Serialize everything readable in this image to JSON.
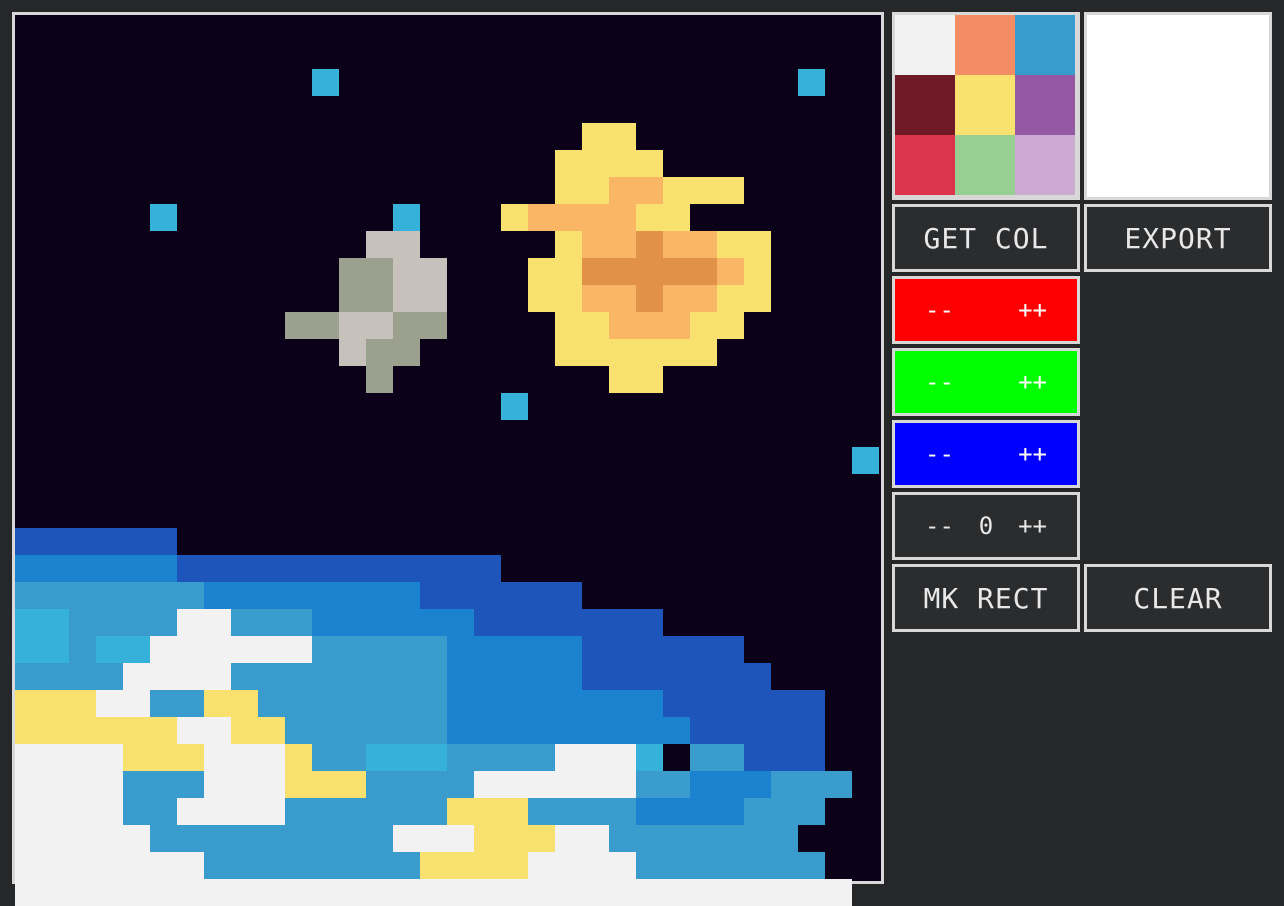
{
  "palette": {
    "colors": [
      "#f2f2f2",
      "#f48c64",
      "#3a9ccd",
      "#6f1a26",
      "#f9e170",
      "#9459a2",
      "#dc344c",
      "#97cf93",
      "#ccaad2"
    ]
  },
  "preview": {
    "color": "#ffffff"
  },
  "buttons": {
    "get_col": "GET COL",
    "export": "EXPORT",
    "mk_rect": "MK RECT",
    "clear": "CLEAR"
  },
  "adjusters": {
    "red": {
      "minus": "--",
      "plus": "++",
      "color": "#ff0000"
    },
    "green": {
      "minus": "--",
      "plus": "++",
      "color": "#00ff00"
    },
    "blue": {
      "minus": "--",
      "plus": "++",
      "color": "#0000ff"
    },
    "size": {
      "minus": "--",
      "value": "0",
      "plus": "++"
    }
  },
  "canvas": {
    "grid_size": 32,
    "background": "#0b0118",
    "colors": {
      "0": "#0b0118",
      "1": "#f2f2f2",
      "2": "#f9e170",
      "3": "#f9b664",
      "4": "#e29148",
      "5": "#c6c2bb",
      "6": "#9ba08f",
      "7": "#1e55bb",
      "8": "#1b82cf",
      "9": "#3a9ccd",
      "10": "#35b1da",
      "11": "#97cf93"
    },
    "rows": [
      "000000000000000000000000000000000",
      "000000000000000000000000000000000",
      "000000000001000000000000000000100",
      "000000000000000000000000000000000",
      "000000000000000000000220000000000",
      "000000000000000000002222000000000",
      "000000000000000000002233222000000",
      "000001000000000100002333322000000",
      "000000000000055000002334332200000",
      "000000000000665500022444443200000",
      "000000000000665500022334332200000",
      "000000000066556600002233322000000",
      "000000000000566000002222220000000",
      "000000000000060000000022000000000",
      "000000000000000000100000000000000",
      "000000000000000000000000000000000",
      "000000000000000000000000000000010",
      "000000000000000000000000000000000",
      "000000000000000000000000000000000",
      "777777000000000000000000000000000",
      "888888777777777777000000000000000",
      "999999988888888777777000000000000",
      "1010999911999888888777777700000000",
      "1010910101111119999988888777777000",
      "999911119999999988888777777700000",
      "222119922999999988888888777777000",
      "222222112299999988888888877777000",
      "1111222111299101010999911110099777",
      "1111999111222999911111199888999",
      "111199111199999922299998888999",
      "11111999999999111222119999999",
      "111111199999999222211119999999",
      "1111111111111111111111111111111"
    ]
  }
}
